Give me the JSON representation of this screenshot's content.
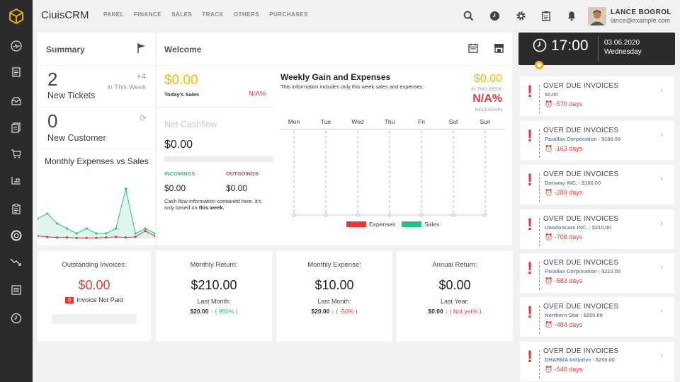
{
  "app": {
    "name": "CiuisCRM"
  },
  "nav": [
    "PANEL",
    "FINANCE",
    "SALES",
    "TRACK",
    "OTHERS",
    "PURCHASES"
  ],
  "user": {
    "name": "LANCE BOGROL",
    "email": "lance@example.com"
  },
  "summary": {
    "title": "Summary",
    "tickets": {
      "count": "2",
      "label": "New Tickets",
      "delta": "+4",
      "delta_label": "in This Week"
    },
    "customers": {
      "count": "0",
      "label": "New Customer"
    },
    "chart_title": "Monthly Expenses vs Sales"
  },
  "welcome": {
    "title": "Welcome",
    "todays_sales": {
      "value": "$0.00",
      "label": "Today's Sales",
      "status": "N/A%"
    },
    "net_cashflow": {
      "label": "Net Cashflow",
      "value": "$0.00"
    },
    "incomings": {
      "label": "INCOMINGS",
      "value": "$0.00"
    },
    "outgoings": {
      "label": "OUTGOINGS",
      "value": "$0.00"
    },
    "note_prefix": "Cash flow information contained here, it's only based on ",
    "note_bold": "this week."
  },
  "weekly": {
    "title": "Weekly Gain and Expenses",
    "subtitle": "This information includes only this week sales and expenses.",
    "value": "$0.00",
    "value_label": "IN THIS WEEK",
    "status": "N/A%",
    "status_label": "RECESSION"
  },
  "chart_data": {
    "type": "line",
    "title": "Weekly Gain and Expenses",
    "categories": [
      "Mon",
      "Tue",
      "Wed",
      "Thu",
      "Fri",
      "Sat",
      "Sun"
    ],
    "series": [
      {
        "name": "Expenses",
        "color": "#e53935",
        "values": [
          0,
          0,
          0,
          0,
          0,
          0,
          0
        ]
      },
      {
        "name": "Sales",
        "color": "#26c281",
        "values": [
          0,
          0,
          0,
          0,
          0,
          0,
          0
        ]
      }
    ],
    "legend": "bottom"
  },
  "monthly_chart": {
    "type": "line",
    "series": [
      {
        "color": "#26c281",
        "values": [
          4,
          5,
          3,
          2,
          1,
          2,
          1,
          1,
          2,
          10,
          1,
          2,
          1
        ]
      },
      {
        "color": "#e53935",
        "values": [
          0.5,
          0.3,
          0.2,
          0.2,
          0.1,
          0.1,
          0.1,
          0.2,
          0.3,
          0.2,
          0.3,
          1.5,
          0.5
        ]
      }
    ]
  },
  "stats": [
    {
      "title": "Outstanding Invoices:",
      "value": "$0.00",
      "badge": "0",
      "badge_label": "Invoice Not Paid",
      "progress": 0
    },
    {
      "title": "Monthly Return:",
      "value": "$210.00",
      "sub_label": "Last Month:",
      "sub_value": "$20.00",
      "sub_arrow": "↑",
      "sub_change": "( 950% )",
      "sub_color": "#26c281"
    },
    {
      "title": "Monthly Expense:",
      "value": "$10.00",
      "sub_label": "Last Month:",
      "sub_value": "$20.00",
      "sub_arrow": "↓",
      "sub_change": "( -50% )",
      "sub_color": "#e53935"
    },
    {
      "title": "Annual Return:",
      "value": "$0.00",
      "sub_label": "Last Year:",
      "sub_value": "$0.00",
      "sub_arrow": "↓",
      "sub_change": "( Not yet% )",
      "sub_color": "#e53935"
    }
  ],
  "clock": {
    "time": "17:00",
    "date": "03.06.2020",
    "day": "Wednesday"
  },
  "invoices": [
    {
      "title": "OVER DUE INVOICES",
      "customer": "",
      "amount": "$0.00",
      "days": "-570 days"
    },
    {
      "title": "OVER DUE INVOICES",
      "customer": "Parallax Corporation",
      "amount": "$100.00",
      "days": "-163 days"
    },
    {
      "title": "OVER DUE INVOICES",
      "customer": "Donway INC.",
      "amount": "$100.00",
      "days": "-289 days"
    },
    {
      "title": "OVER DUE INVOICES",
      "customer": "Unadoncare INC.",
      "amount": "$210.00",
      "days": "-708 days"
    },
    {
      "title": "OVER DUE INVOICES",
      "customer": "Parallax Corporation",
      "amount": "$210.00",
      "days": "-583 days"
    },
    {
      "title": "OVER DUE INVOICES",
      "customer": "Northern Star",
      "amount": "$200.00",
      "days": "-484 days"
    },
    {
      "title": "OVER DUE INVOICES",
      "customer": "DHARMA Initiative",
      "amount": "$200.00",
      "days": "-540 days"
    }
  ],
  "colors": {
    "accent": "#f5b800",
    "danger": "#e53935",
    "success": "#26c281",
    "sidebar": "#2b2b2b"
  }
}
